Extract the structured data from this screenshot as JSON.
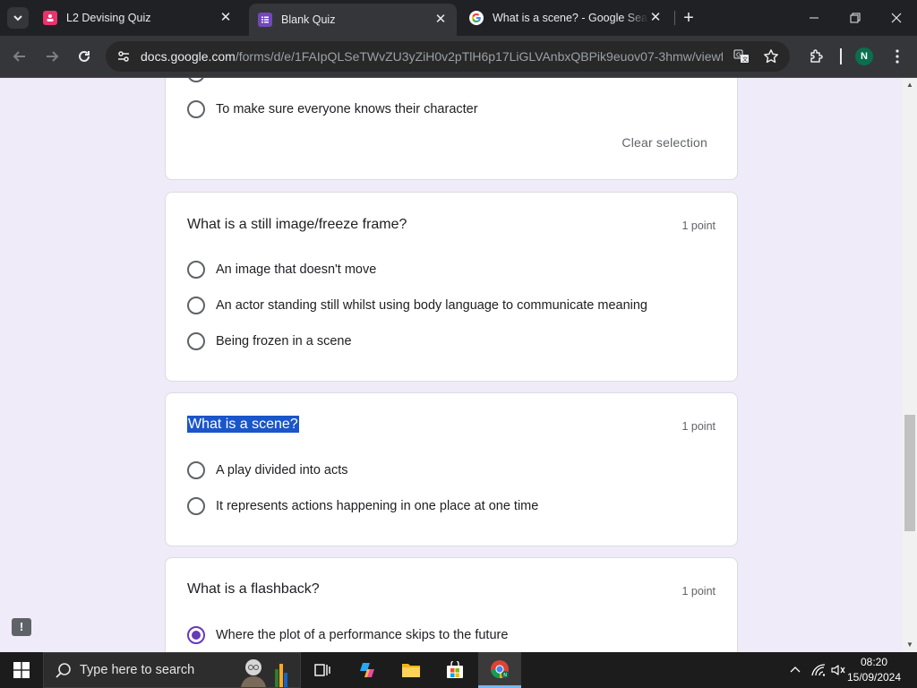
{
  "browser": {
    "tabs": [
      {
        "title": "L2 Devising Quiz",
        "active": false
      },
      {
        "title": "Blank Quiz",
        "active": true
      },
      {
        "title": "What is a scene? - Google Search",
        "active": false
      }
    ],
    "url_host": "docs.google.com",
    "url_path": "/forms/d/e/1FAIpQLSeTWvZU3yZiH0v2pTlH6p17LiGLVAnbxQBPik9euov07-3hmw/viewf...",
    "profile_initial": "N"
  },
  "form": {
    "partial_question": {
      "options": [
        {
          "label": "To make sure everyone knows their character",
          "checked": false
        }
      ],
      "clear_selection": "Clear selection"
    },
    "questions": [
      {
        "title": "What is a still image/freeze frame?",
        "points": "1 point",
        "options": [
          {
            "label": "An image that doesn't move",
            "checked": false
          },
          {
            "label": "An actor standing still whilst using body language to communicate meaning",
            "checked": false
          },
          {
            "label": "Being frozen in a scene",
            "checked": false
          }
        ]
      },
      {
        "title": "What is a scene?",
        "title_selected": true,
        "points": "1 point",
        "options": [
          {
            "label": "A play divided into acts",
            "checked": false
          },
          {
            "label": "It represents actions happening in one place at one time",
            "checked": false
          }
        ]
      },
      {
        "title": "What is a flashback?",
        "points": "1 point",
        "options": [
          {
            "label": "Where the plot of a performance skips to the future",
            "checked": true
          }
        ]
      }
    ]
  },
  "taskbar": {
    "search_placeholder": "Type here to search",
    "time": "08:20",
    "date": "15/09/2024"
  },
  "colors": {
    "form_accent": "#673ab7",
    "page_bg": "#f0ebf8",
    "selection": "#1a55c9"
  }
}
